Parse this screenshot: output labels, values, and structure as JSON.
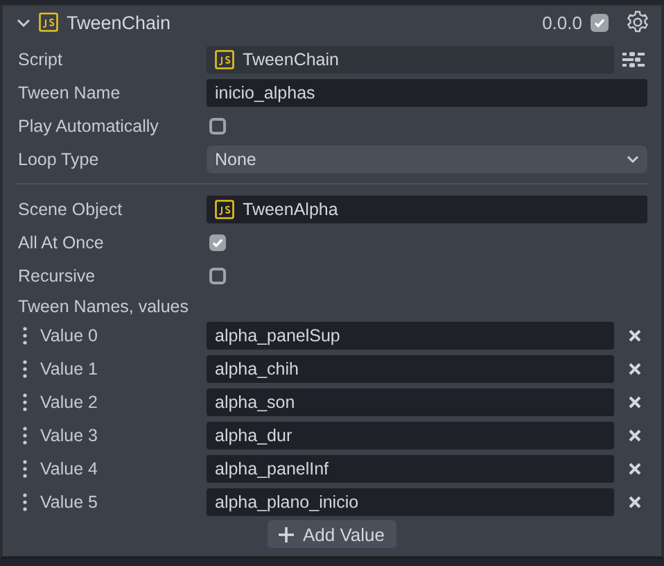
{
  "component": {
    "title": "TweenChain",
    "version": "0.0.0",
    "enabled": true,
    "expanded": true
  },
  "sections": [
    {
      "properties": [
        {
          "kind": "script",
          "label": "Script",
          "value": "TweenChain"
        },
        {
          "kind": "text",
          "label": "Tween Name",
          "value": "inicio_alphas"
        },
        {
          "kind": "checkbox",
          "label": "Play Automatically",
          "checked": false
        },
        {
          "kind": "select",
          "label": "Loop Type",
          "value": "None"
        }
      ]
    },
    {
      "properties": [
        {
          "kind": "object",
          "label": "Scene Object",
          "value": "TweenAlpha"
        },
        {
          "kind": "checkbox",
          "label": "All At Once",
          "checked": true
        },
        {
          "kind": "checkbox",
          "label": "Recursive",
          "checked": false
        }
      ]
    }
  ],
  "list": {
    "label": "Tween Names, values",
    "items": [
      {
        "label": "Value 0",
        "value": "alpha_panelSup"
      },
      {
        "label": "Value 1",
        "value": "alpha_chih"
      },
      {
        "label": "Value 2",
        "value": "alpha_son"
      },
      {
        "label": "Value 3",
        "value": "alpha_dur"
      },
      {
        "label": "Value 4",
        "value": "alpha_panelInf"
      },
      {
        "label": "Value 5",
        "value": "alpha_plano_inicio"
      }
    ],
    "add_button": "Add Value"
  }
}
